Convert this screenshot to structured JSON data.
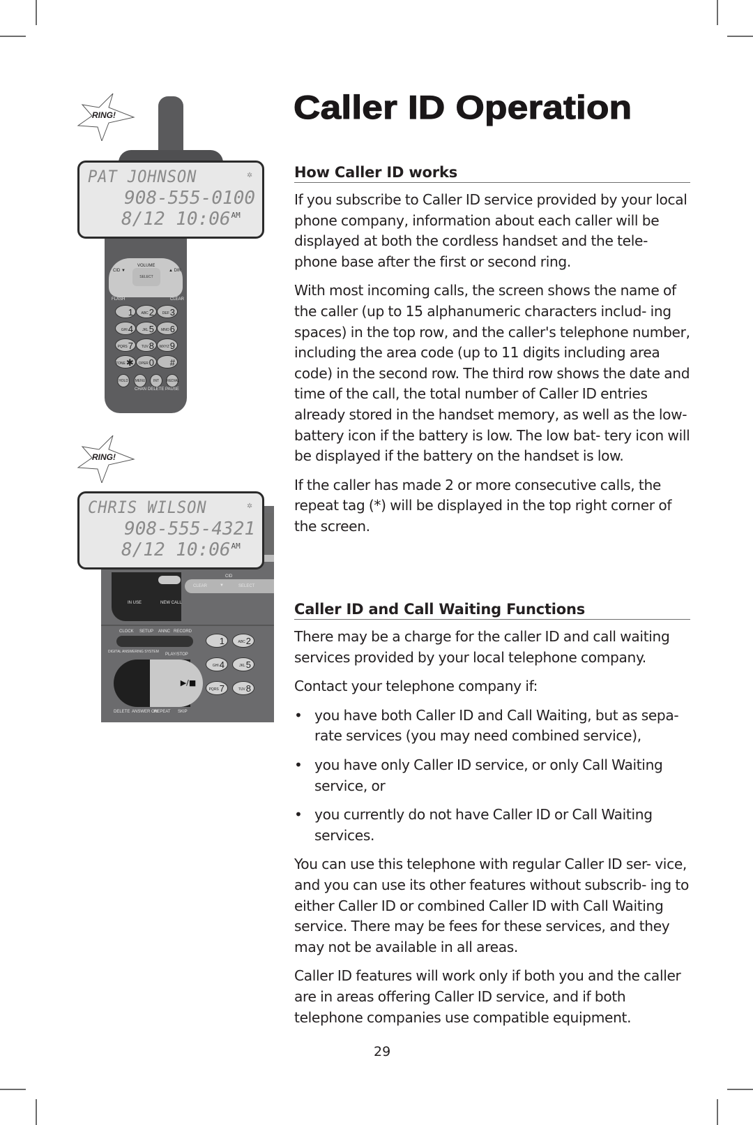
{
  "page": {
    "title": "Caller ID Operation",
    "page_number": "29"
  },
  "illustration": {
    "ring_label": "RING!",
    "handset_display": {
      "name": "PAT JOHNSON",
      "repeat_tag": "✲",
      "number": "908-555-0100",
      "date_time": "8/12 10:06",
      "ampm": "AM"
    },
    "base_display": {
      "name": "CHRIS WILSON",
      "repeat_tag": "✲",
      "number": "908-555-4321",
      "date_time": "8/12 10:06",
      "ampm": "AM"
    },
    "handset_labels": {
      "volume": "VOLUME",
      "cid": "CID ▼",
      "dir": "▲ DIR",
      "select": "SELECT",
      "flash": "FLASH",
      "clear": "CLEAR",
      "chan": "CHAN",
      "delete": "DELETE",
      "pause": "PAUSE",
      "hold": "HOLD",
      "menu": "MENU",
      "int": "INT",
      "redial": "REDIAL"
    },
    "handset_keys": [
      {
        "sub": "",
        "main": "1"
      },
      {
        "sub": "ABC",
        "main": "2"
      },
      {
        "sub": "DEF",
        "main": "3"
      },
      {
        "sub": "GHI",
        "main": "4"
      },
      {
        "sub": "JKL",
        "main": "5"
      },
      {
        "sub": "MNO",
        "main": "6"
      },
      {
        "sub": "PQRS",
        "main": "7"
      },
      {
        "sub": "TUV",
        "main": "8"
      },
      {
        "sub": "WXYZ",
        "main": "9"
      },
      {
        "sub": "TONE",
        "main": "✱"
      },
      {
        "sub": "OPER",
        "main": "0"
      },
      {
        "sub": "",
        "main": "#"
      }
    ],
    "base_labels": {
      "in_use": "IN USE",
      "new_call": "NEW CALL",
      "cid": "CID",
      "clear": "CLEAR",
      "select": "SELECT",
      "clock": "CLOCK",
      "setup": "SETUP",
      "annc": "ANNC",
      "record": "RECORD",
      "das": "DIGITAL ANSWERING SYSTEM",
      "play_stop": "PLAY/STOP",
      "play_symbol": "▶/■",
      "delete": "DELETE",
      "answer_on": "ANSWER ON",
      "repeat": "REPEAT",
      "skip": "SKIP"
    },
    "base_keys": [
      {
        "sub": "",
        "main": "1"
      },
      {
        "sub": "ABC",
        "main": "2"
      },
      {
        "sub": "GHI",
        "main": "4"
      },
      {
        "sub": "JKL",
        "main": "5"
      },
      {
        "sub": "PQRS",
        "main": "7"
      },
      {
        "sub": "TUV",
        "main": "8"
      }
    ]
  },
  "sections": [
    {
      "heading": "How Caller ID works",
      "paragraphs": [
        "If you subscribe to Caller ID service provided by your local phone company, information about each caller will be displayed at both the cordless handset and the tele- phone base after the first or second ring.",
        "With most incoming calls, the screen shows the name of the caller (up to 15 alphanumeric characters includ- ing spaces) in the top row, and the caller's telephone number, including the area code (up to 11 digits including area code) in the second row. The third row shows the date and time of the call, the total number of Caller ID entries already stored in the handset memory, as well as the low-battery icon if the battery is low. The low bat- tery icon will be displayed if the battery on the handset is low.",
        "If the caller has made 2 or more consecutive calls, the repeat tag (*) will be displayed in the top right corner of the screen."
      ]
    },
    {
      "heading": "Caller ID and Call Waiting Functions",
      "intro": [
        "There may be a charge for the caller ID and call waiting services provided by your local telephone company.",
        "Contact your telephone company if:"
      ],
      "bullet_char": "•",
      "bullets": [
        "you have both Caller ID and Call Waiting, but as sepa- rate services (you may need combined service),",
        "you have only Caller ID service, or only Call Waiting service, or",
        "you currently do not have Caller ID or Call Waiting services."
      ],
      "outro": [
        "You can use this telephone with regular Caller ID ser- vice, and you can use its other features without subscrib- ing to either Caller ID or combined Caller ID with Call Waiting service. There may be fees for these services, and they may not be available in all areas.",
        "Caller ID features will work only if both you and the caller are in areas offering Caller ID service, and if both telephone companies use compatible equipment."
      ]
    }
  ]
}
